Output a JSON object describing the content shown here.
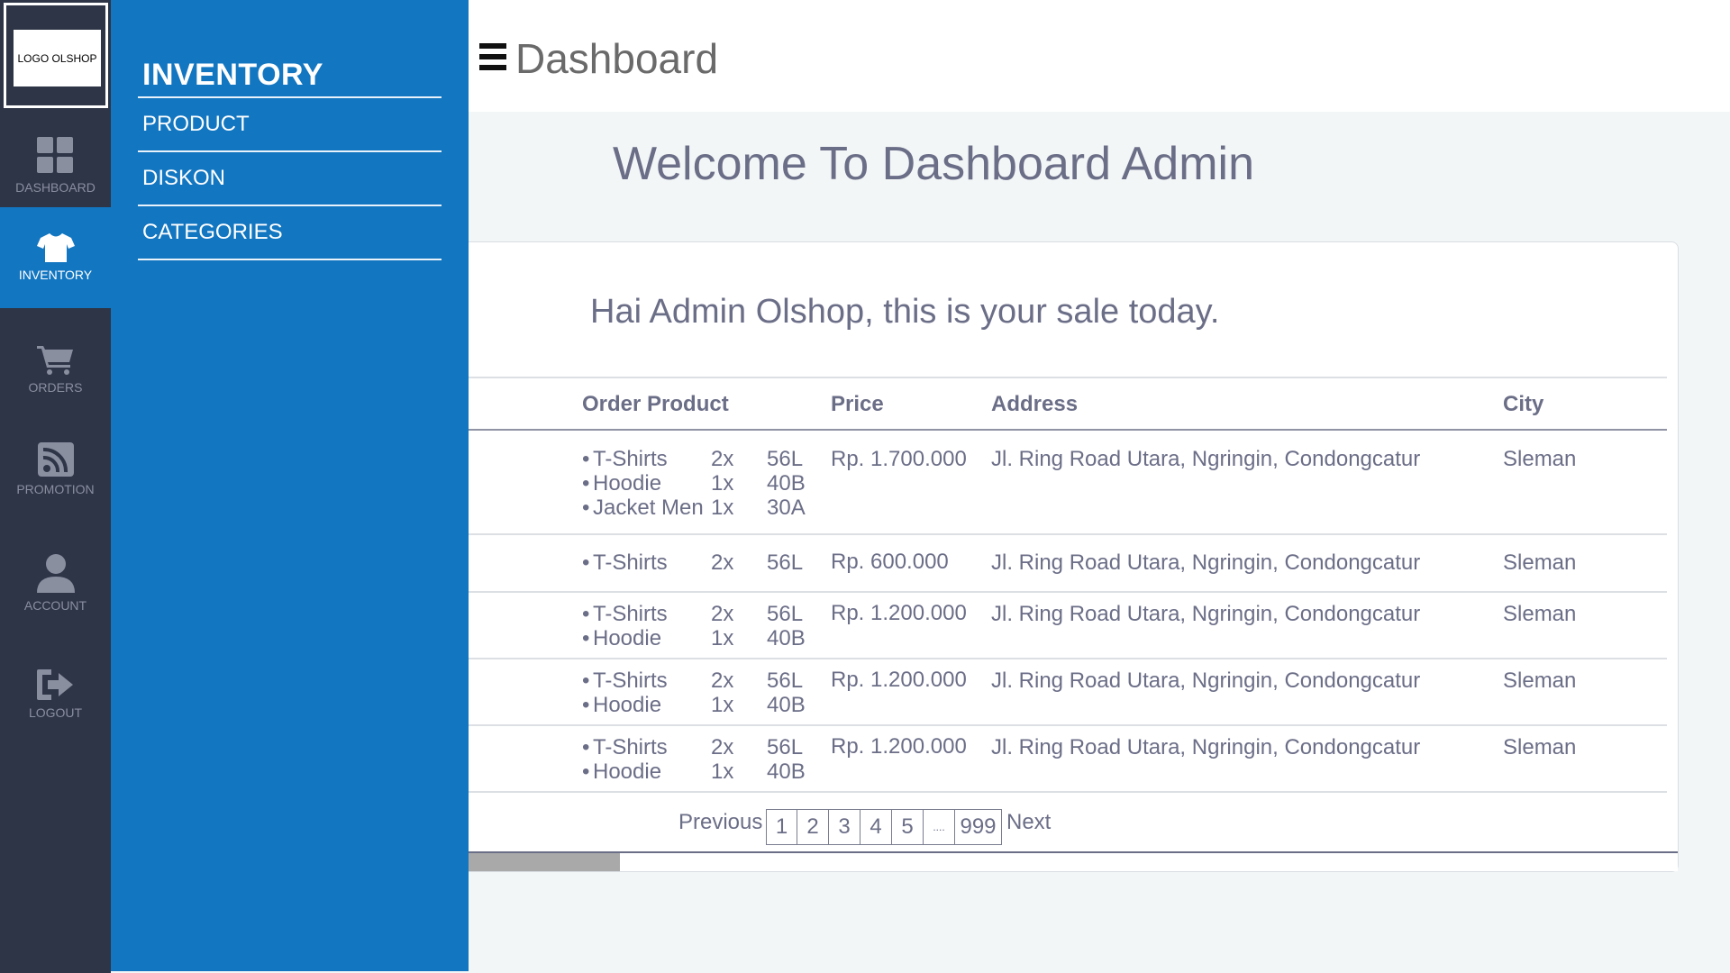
{
  "logo": {
    "text": "LOGO OLSHOP"
  },
  "rail": {
    "items": [
      {
        "label": "DASHBOARD",
        "icon": "dashboard-grid-icon"
      },
      {
        "label": "INVENTORY",
        "icon": "tshirt-icon"
      },
      {
        "label": "ORDERS",
        "icon": "cart-icon"
      },
      {
        "label": "PROMOTION",
        "icon": "rss-icon"
      },
      {
        "label": "ACCOUNT",
        "icon": "user-icon"
      },
      {
        "label": "LOGOUT",
        "icon": "logout-icon"
      }
    ]
  },
  "panel": {
    "title": "INVENTORY",
    "links": [
      "PRODUCT",
      "DISKON",
      "CATEGORIES"
    ]
  },
  "header": {
    "title": "Dashboard"
  },
  "main": {
    "welcome": "Welcome To Dashboard Admin",
    "greeting": "Hai Admin Olshop, this is your sale today.",
    "columns": [
      "Order Product",
      "Price",
      "Address",
      "City"
    ],
    "rows": [
      {
        "items": [
          {
            "name": "T-Shirts",
            "qty": "2x",
            "size": "56L"
          },
          {
            "name": "Hoodie",
            "qty": "1x",
            "size": "40B"
          },
          {
            "name": "Jacket Men",
            "qty": "1x",
            "size": "30A"
          }
        ],
        "price": "Rp. 1.700.000",
        "address": "Jl. Ring Road Utara, Ngringin, Condongcatur",
        "city": "Sleman"
      },
      {
        "items": [
          {
            "name": "T-Shirts",
            "qty": "2x",
            "size": "56L"
          }
        ],
        "price": "Rp. 600.000",
        "address": "Jl. Ring Road Utara, Ngringin, Condongcatur",
        "city": "Sleman"
      },
      {
        "items": [
          {
            "name": "T-Shirts",
            "qty": "2x",
            "size": "56L"
          },
          {
            "name": "Hoodie",
            "qty": "1x",
            "size": "40B"
          }
        ],
        "price": "Rp. 1.200.000",
        "address": "Jl. Ring Road Utara, Ngringin, Condongcatur",
        "city": "Sleman"
      },
      {
        "items": [
          {
            "name": "T-Shirts",
            "qty": "2x",
            "size": "56L"
          },
          {
            "name": "Hoodie",
            "qty": "1x",
            "size": "40B"
          }
        ],
        "price": "Rp. 1.200.000",
        "address": "Jl. Ring Road Utara, Ngringin, Condongcatur",
        "city": "Sleman"
      },
      {
        "items": [
          {
            "name": "T-Shirts",
            "qty": "2x",
            "size": "56L"
          },
          {
            "name": "Hoodie",
            "qty": "1x",
            "size": "40B"
          }
        ],
        "price": "Rp. 1.200.000",
        "address": "Jl. Ring Road Utara, Ngringin, Condongcatur",
        "city": "Sleman"
      }
    ],
    "pagination": {
      "previous": "Previous",
      "next": "Next",
      "pages": [
        "1",
        "2",
        "3",
        "4",
        "5",
        "....",
        "999"
      ]
    }
  },
  "colors": {
    "rail_bg": "#2e3546",
    "accent_blue": "#1276c1",
    "text_muted": "#6b6e87",
    "content_bg": "#f3f6f7"
  }
}
